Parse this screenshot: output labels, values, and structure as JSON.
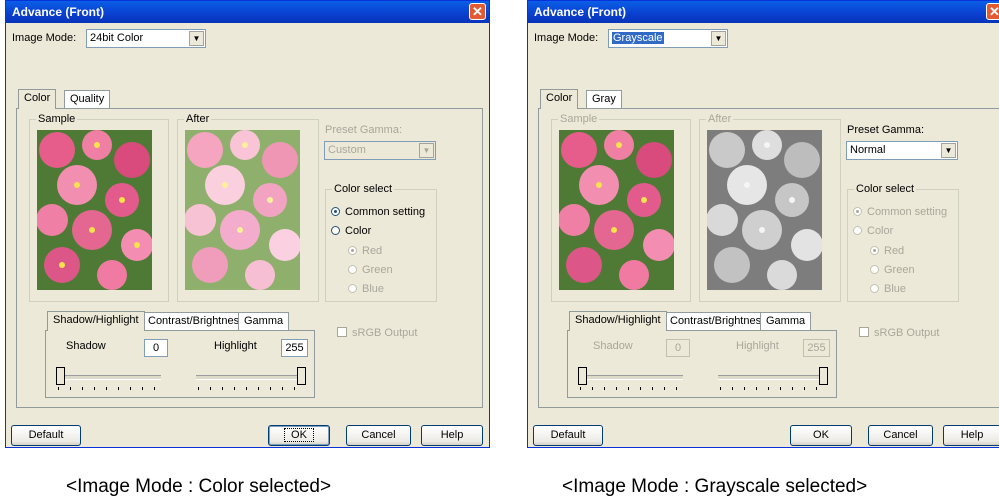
{
  "left": {
    "title": "Advance (Front)",
    "image_mode_label": "Image Mode:",
    "image_mode_value": "24bit Color",
    "tabs": [
      "Color",
      "Quality"
    ],
    "sample_label": "Sample",
    "after_label": "After",
    "preset_gamma_label": "Preset Gamma:",
    "preset_gamma_value": "Custom",
    "color_select_label": "Color select",
    "radio_common": "Common setting",
    "radio_color": "Color",
    "radio_red": "Red",
    "radio_green": "Green",
    "radio_blue": "Blue",
    "subtabs": [
      "Shadow/Highlight",
      "Contrast/Brightness",
      "Gamma"
    ],
    "shadow_label": "Shadow",
    "shadow_value": "0",
    "highlight_label": "Highlight",
    "highlight_value": "255",
    "srgb_label": "sRGB Output",
    "default_btn": "Default",
    "ok_btn": "OK",
    "cancel_btn": "Cancel",
    "help_btn": "Help"
  },
  "right": {
    "title": "Advance (Front)",
    "image_mode_label": "Image Mode:",
    "image_mode_value": "Grayscale",
    "tabs": [
      "Color",
      "Gray"
    ],
    "sample_label": "Sample",
    "after_label": "After",
    "preset_gamma_label": "Preset Gamma:",
    "preset_gamma_value": "Normal",
    "color_select_label": "Color select",
    "radio_common": "Common setting",
    "radio_color": "Color",
    "radio_red": "Red",
    "radio_green": "Green",
    "radio_blue": "Blue",
    "subtabs": [
      "Shadow/Highlight",
      "Contrast/Brightness",
      "Gamma"
    ],
    "shadow_label": "Shadow",
    "shadow_value": "0",
    "highlight_label": "Highlight",
    "highlight_value": "255",
    "srgb_label": "sRGB Output",
    "default_btn": "Default",
    "ok_btn": "OK",
    "cancel_btn": "Cancel",
    "help_btn": "Help"
  },
  "captions": {
    "left": "<Image Mode : Color selected>",
    "right": "<Image Mode : Grayscale selected>"
  },
  "colors": {
    "title_bar": "#0a3fcf",
    "dialog_bg": "#ece9d8",
    "selection": "#316ac5"
  }
}
